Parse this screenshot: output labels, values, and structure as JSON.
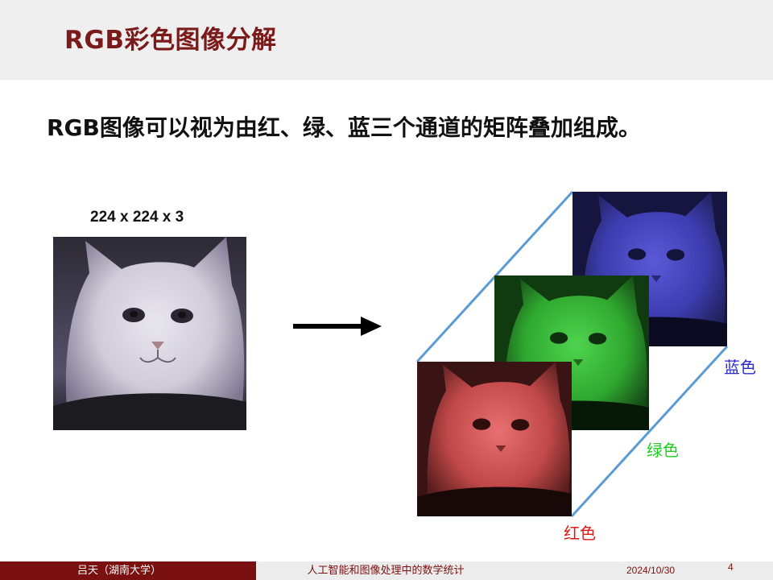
{
  "slide": {
    "title": "RGB彩色图像分解",
    "headline": "RGB图像可以视为由红、绿、蓝三个通道的矩阵叠加组成。",
    "image_dims": "224 x 224 x 3",
    "channels": {
      "blue": {
        "label": "蓝色",
        "color": "#2a2acc",
        "tint": "#4a4ad8"
      },
      "green": {
        "label": "绿色",
        "color": "#22cc22",
        "tint": "#2ecf2e"
      },
      "red": {
        "label": "红色",
        "color": "#e01818",
        "tint": "#e05050"
      }
    },
    "connector_color": "#5b9bd5"
  },
  "footer": {
    "author": "吕天（湖南大学）",
    "course": "人工智能和图像处理中的数学统计",
    "date": "2024/10/30",
    "page": "4"
  }
}
